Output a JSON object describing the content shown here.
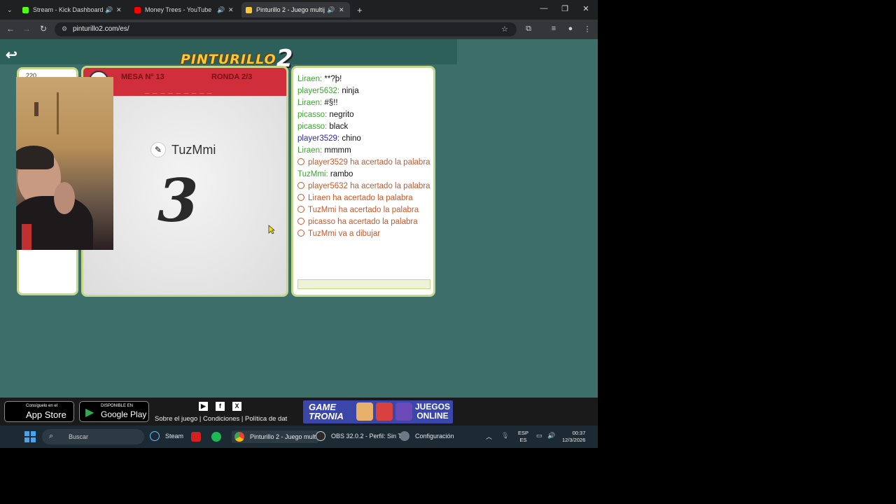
{
  "browser": {
    "tabs": [
      {
        "label": "Stream - Kick Dashboard",
        "color": "#53fc18"
      },
      {
        "label": "Money Trees - YouTube",
        "color": "#ff0000"
      },
      {
        "label": "Pinturillo 2 - Juego multiju",
        "color": "#f6c93b"
      }
    ],
    "url": "pinturillo2.com/es/"
  },
  "game": {
    "logo_text": "PINTURILLO",
    "logo_num": "2",
    "player_score": "220",
    "table_label": "MESA Nº 13",
    "round_label": "RONDA 2/3",
    "word_hint": "_ _ _ _ _ _ _ _ _",
    "drawer_name": "TuzMmi",
    "countdown": "3"
  },
  "chat": {
    "messages": [
      {
        "who": "Liraen:",
        "text": "**?þ!",
        "type": "user"
      },
      {
        "who": "player5632:",
        "text": "ninja",
        "type": "user"
      },
      {
        "who": "Liraen:",
        "text": "#§!!",
        "type": "user"
      },
      {
        "who": "picasso:",
        "text": "negrito",
        "type": "user"
      },
      {
        "who": "picasso:",
        "text": "black",
        "type": "user"
      },
      {
        "who": "player3529:",
        "text": "chino",
        "type": "user-blue"
      },
      {
        "who": "Liraen:",
        "text": "mmmm",
        "type": "user"
      },
      {
        "text": "player3529 ha acertado la palabra",
        "type": "sys"
      },
      {
        "who": "TuzMmi:",
        "text": "rambo",
        "type": "user"
      },
      {
        "text": "player5632 ha acertado la palabra",
        "type": "sys"
      },
      {
        "text": "Liraen ha acertado la palabra",
        "type": "sys"
      },
      {
        "text": "TuzMmi ha acertado la palabra",
        "type": "sys"
      },
      {
        "text": "picasso ha acertado la palabra",
        "type": "sys"
      },
      {
        "text": "TuzMmi va a dibujar",
        "type": "sys"
      }
    ]
  },
  "footer": {
    "appstore_small": "Consíguelo en el",
    "appstore_big": "App Store",
    "gplay_small": "DISPONIBLE EN",
    "gplay_big": "Google Play",
    "links": "Sobre el juego | Condiciones | Política de dat",
    "gametronia_1": "GAME",
    "gametronia_2": "TRONIA",
    "juegos_1": "JUEGOS",
    "juegos_2": "ONLINE"
  },
  "taskbar": {
    "search": "Buscar",
    "steam": "Steam",
    "chrome": "Pinturillo 2 - Juego mult",
    "obs": "OBS 32.0.2 - Perfil: Sin T",
    "config": "Configuración",
    "lang1": "ESP",
    "lang2": "ES",
    "time": "00:37",
    "date": "12/3/2026"
  }
}
